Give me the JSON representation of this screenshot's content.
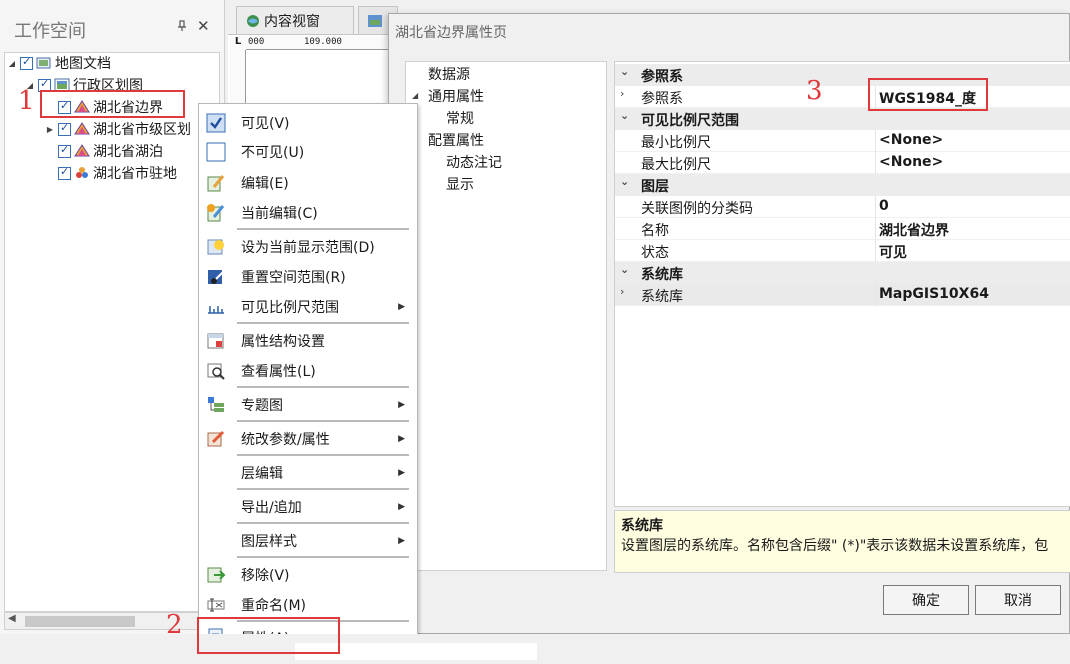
{
  "workspace": {
    "title": "工作空间",
    "pin": "📌",
    "close": "✕",
    "tree": [
      {
        "label": "地图文档"
      },
      {
        "label": "行政区划图"
      },
      {
        "label": "湖北省边界"
      },
      {
        "label": "湖北省市级区划"
      },
      {
        "label": "湖北省湖泊"
      },
      {
        "label": "湖北省市驻地"
      }
    ]
  },
  "tabs": [
    {
      "label": "内容视窗"
    },
    {
      "label": ""
    }
  ],
  "ruler": {
    "corner": "L",
    "t0": "000",
    "t1": "109.000"
  },
  "context_menu": {
    "items": [
      {
        "label": "可见(V)"
      },
      {
        "label": "不可见(U)"
      },
      {
        "label": "编辑(E)"
      },
      {
        "label": "当前编辑(C)"
      },
      {
        "label": "设为当前显示范围(D)"
      },
      {
        "label": "重置空间范围(R)"
      },
      {
        "label": "可见比例尺范围"
      },
      {
        "label": "属性结构设置"
      },
      {
        "label": "查看属性(L)"
      },
      {
        "label": "专题图"
      },
      {
        "label": "统改参数/属性"
      },
      {
        "label": "层编辑"
      },
      {
        "label": "导出/追加"
      },
      {
        "label": "图层样式"
      },
      {
        "label": "移除(V)"
      },
      {
        "label": "重命名(M)"
      },
      {
        "label": "属性(A)..."
      }
    ]
  },
  "dialog": {
    "title": "湖北省边界属性页",
    "nav": [
      {
        "label": "数据源"
      },
      {
        "label": "通用属性"
      },
      {
        "label": "常规"
      },
      {
        "label": "配置属性"
      },
      {
        "label": "动态注记"
      },
      {
        "label": "显示"
      }
    ],
    "grid": {
      "cat_ref": "参照系",
      "ref_name": "参照系",
      "ref_value": "WGS1984_度",
      "cat_scale": "可见比例尺范围",
      "min_name": "最小比例尺",
      "min_value": "<None>",
      "max_name": "最大比例尺",
      "max_value": "<None>",
      "cat_layer": "图层",
      "legend_name": "关联图例的分类码",
      "legend_value": "0",
      "name_name": "名称",
      "name_value": "湖北省边界",
      "state_name": "状态",
      "state_value": "可见",
      "cat_sys": "系统库",
      "sys_name": "系统库",
      "sys_value": "MapGIS10X64"
    },
    "description": {
      "title": "系统库",
      "text": "设置图层的系统库。名称包含后缀\" (*)\"表示该数据未设置系统库，包"
    },
    "ok_label": "确定",
    "cancel_label": "取消"
  },
  "annotations": [
    "1",
    "2",
    "3"
  ],
  "colors": {
    "highlight": "#e0393b"
  }
}
